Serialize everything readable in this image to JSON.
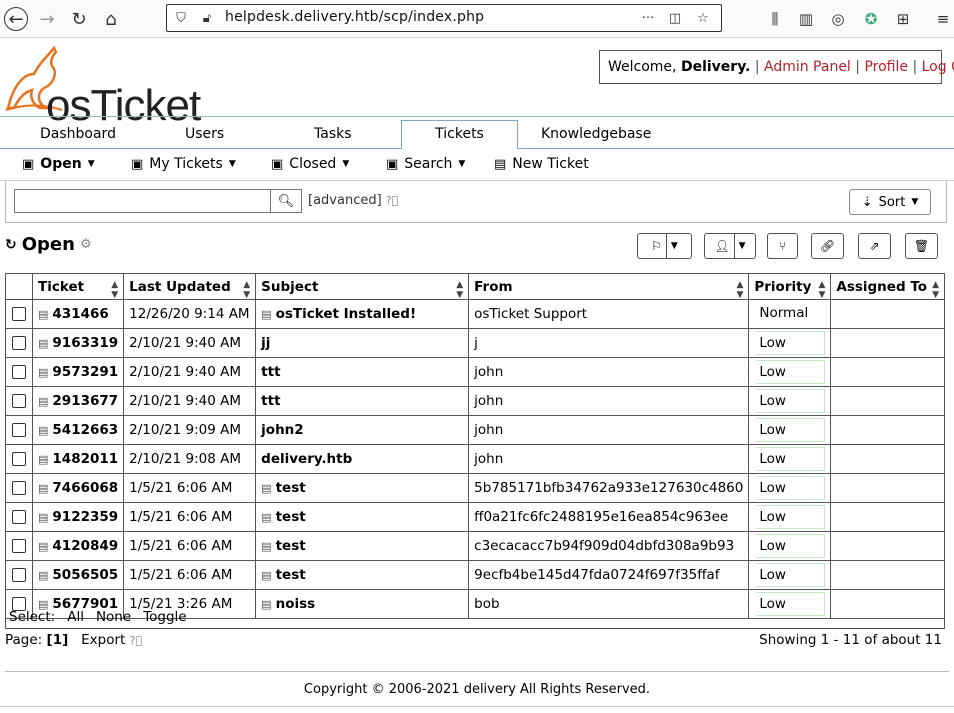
{
  "browser": {
    "url": "helpdesk.delivery.htb/scp/index.php"
  },
  "header": {
    "logo_text": "osTicket",
    "welcome": "Welcome, ",
    "user": "Delivery.",
    "links": [
      "Admin Panel",
      "Profile",
      "Log Out"
    ]
  },
  "tabs": [
    "Dashboard",
    "Users",
    "Tasks",
    "Tickets",
    "Knowledgebase"
  ],
  "subnav": [
    "Open",
    "My Tickets",
    "Closed",
    "Search",
    "New Ticket"
  ],
  "search": {
    "value": "",
    "advanced_label": "[advanced]",
    "sort_label": "Sort"
  },
  "page_title": "Open",
  "table": {
    "headers": [
      "Ticket",
      "Last Updated",
      "Subject",
      "From",
      "Priority",
      "Assigned To"
    ],
    "rows": [
      {
        "ticket": "431466",
        "updated": "12/26/20 9:14 AM",
        "subject": "osTicket Installed!",
        "from": "osTicket Support",
        "priority": "Normal",
        "assigned": "",
        "subj_icon": true
      },
      {
        "ticket": "9163319",
        "updated": "2/10/21 9:40 AM",
        "subject": "jj",
        "from": "j",
        "priority": "Low",
        "assigned": "",
        "subj_icon": false
      },
      {
        "ticket": "9573291",
        "updated": "2/10/21 9:40 AM",
        "subject": "ttt",
        "from": "john",
        "priority": "Low",
        "assigned": "",
        "subj_icon": false
      },
      {
        "ticket": "2913677",
        "updated": "2/10/21 9:40 AM",
        "subject": "ttt",
        "from": "john",
        "priority": "Low",
        "assigned": "",
        "subj_icon": false
      },
      {
        "ticket": "5412663",
        "updated": "2/10/21 9:09 AM",
        "subject": "john2",
        "from": "john",
        "priority": "Low",
        "assigned": "",
        "subj_icon": false
      },
      {
        "ticket": "1482011",
        "updated": "2/10/21 9:08 AM",
        "subject": "delivery.htb",
        "from": "john",
        "priority": "Low",
        "assigned": "",
        "subj_icon": false
      },
      {
        "ticket": "7466068",
        "updated": "1/5/21 6:06 AM",
        "subject": "test",
        "from": "5b785171bfb34762a933e127630c4860",
        "priority": "Low",
        "assigned": "",
        "subj_icon": true
      },
      {
        "ticket": "9122359",
        "updated": "1/5/21 6:06 AM",
        "subject": "test",
        "from": "ff0a21fc6fc2488195e16ea854c963ee",
        "priority": "Low",
        "assigned": "",
        "subj_icon": true
      },
      {
        "ticket": "4120849",
        "updated": "1/5/21 6:06 AM",
        "subject": "test",
        "from": "c3ecacacc7b94f909d04dbfd308a9b93",
        "priority": "Low",
        "assigned": "",
        "subj_icon": true
      },
      {
        "ticket": "5056505",
        "updated": "1/5/21 6:06 AM",
        "subject": "test",
        "from": "9ecfb4be145d47fda0724f697f35ffaf",
        "priority": "Low",
        "assigned": "",
        "subj_icon": true
      },
      {
        "ticket": "5677901",
        "updated": "1/5/21 3:26 AM",
        "subject": "noiss",
        "from": "bob",
        "priority": "Low",
        "assigned": "",
        "subj_icon": true
      }
    ]
  },
  "select_row": {
    "label": "Select:",
    "all": "All",
    "none": "None",
    "toggle": "Toggle"
  },
  "pagination": {
    "label": "Page:",
    "current": "[1]",
    "export": "Export"
  },
  "showing": "Showing 1 - 11 of about 11",
  "footer": "Copyright © 2006-2021 delivery All Rights Reserved.",
  "colors": {
    "link": "#b6202a",
    "tab_border": "#7aa9c9",
    "logo_orange": "#e8731c"
  }
}
